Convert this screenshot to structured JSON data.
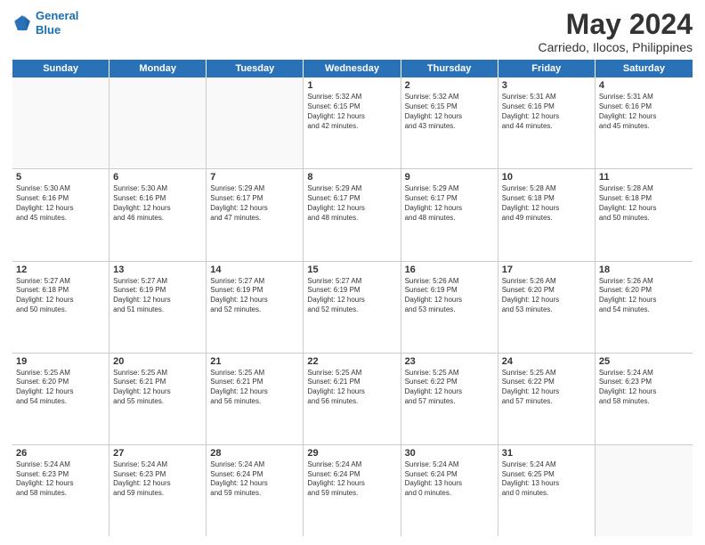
{
  "header": {
    "logo_line1": "General",
    "logo_line2": "Blue",
    "month": "May 2024",
    "location": "Carriedo, Ilocos, Philippines"
  },
  "weekdays": [
    "Sunday",
    "Monday",
    "Tuesday",
    "Wednesday",
    "Thursday",
    "Friday",
    "Saturday"
  ],
  "rows": [
    [
      {
        "day": "",
        "text": ""
      },
      {
        "day": "",
        "text": ""
      },
      {
        "day": "",
        "text": ""
      },
      {
        "day": "1",
        "text": "Sunrise: 5:32 AM\nSunset: 6:15 PM\nDaylight: 12 hours\nand 42 minutes."
      },
      {
        "day": "2",
        "text": "Sunrise: 5:32 AM\nSunset: 6:15 PM\nDaylight: 12 hours\nand 43 minutes."
      },
      {
        "day": "3",
        "text": "Sunrise: 5:31 AM\nSunset: 6:16 PM\nDaylight: 12 hours\nand 44 minutes."
      },
      {
        "day": "4",
        "text": "Sunrise: 5:31 AM\nSunset: 6:16 PM\nDaylight: 12 hours\nand 45 minutes."
      }
    ],
    [
      {
        "day": "5",
        "text": "Sunrise: 5:30 AM\nSunset: 6:16 PM\nDaylight: 12 hours\nand 45 minutes."
      },
      {
        "day": "6",
        "text": "Sunrise: 5:30 AM\nSunset: 6:16 PM\nDaylight: 12 hours\nand 46 minutes."
      },
      {
        "day": "7",
        "text": "Sunrise: 5:29 AM\nSunset: 6:17 PM\nDaylight: 12 hours\nand 47 minutes."
      },
      {
        "day": "8",
        "text": "Sunrise: 5:29 AM\nSunset: 6:17 PM\nDaylight: 12 hours\nand 48 minutes."
      },
      {
        "day": "9",
        "text": "Sunrise: 5:29 AM\nSunset: 6:17 PM\nDaylight: 12 hours\nand 48 minutes."
      },
      {
        "day": "10",
        "text": "Sunrise: 5:28 AM\nSunset: 6:18 PM\nDaylight: 12 hours\nand 49 minutes."
      },
      {
        "day": "11",
        "text": "Sunrise: 5:28 AM\nSunset: 6:18 PM\nDaylight: 12 hours\nand 50 minutes."
      }
    ],
    [
      {
        "day": "12",
        "text": "Sunrise: 5:27 AM\nSunset: 6:18 PM\nDaylight: 12 hours\nand 50 minutes."
      },
      {
        "day": "13",
        "text": "Sunrise: 5:27 AM\nSunset: 6:19 PM\nDaylight: 12 hours\nand 51 minutes."
      },
      {
        "day": "14",
        "text": "Sunrise: 5:27 AM\nSunset: 6:19 PM\nDaylight: 12 hours\nand 52 minutes."
      },
      {
        "day": "15",
        "text": "Sunrise: 5:27 AM\nSunset: 6:19 PM\nDaylight: 12 hours\nand 52 minutes."
      },
      {
        "day": "16",
        "text": "Sunrise: 5:26 AM\nSunset: 6:19 PM\nDaylight: 12 hours\nand 53 minutes."
      },
      {
        "day": "17",
        "text": "Sunrise: 5:26 AM\nSunset: 6:20 PM\nDaylight: 12 hours\nand 53 minutes."
      },
      {
        "day": "18",
        "text": "Sunrise: 5:26 AM\nSunset: 6:20 PM\nDaylight: 12 hours\nand 54 minutes."
      }
    ],
    [
      {
        "day": "19",
        "text": "Sunrise: 5:25 AM\nSunset: 6:20 PM\nDaylight: 12 hours\nand 54 minutes."
      },
      {
        "day": "20",
        "text": "Sunrise: 5:25 AM\nSunset: 6:21 PM\nDaylight: 12 hours\nand 55 minutes."
      },
      {
        "day": "21",
        "text": "Sunrise: 5:25 AM\nSunset: 6:21 PM\nDaylight: 12 hours\nand 56 minutes."
      },
      {
        "day": "22",
        "text": "Sunrise: 5:25 AM\nSunset: 6:21 PM\nDaylight: 12 hours\nand 56 minutes."
      },
      {
        "day": "23",
        "text": "Sunrise: 5:25 AM\nSunset: 6:22 PM\nDaylight: 12 hours\nand 57 minutes."
      },
      {
        "day": "24",
        "text": "Sunrise: 5:25 AM\nSunset: 6:22 PM\nDaylight: 12 hours\nand 57 minutes."
      },
      {
        "day": "25",
        "text": "Sunrise: 5:24 AM\nSunset: 6:23 PM\nDaylight: 12 hours\nand 58 minutes."
      }
    ],
    [
      {
        "day": "26",
        "text": "Sunrise: 5:24 AM\nSunset: 6:23 PM\nDaylight: 12 hours\nand 58 minutes."
      },
      {
        "day": "27",
        "text": "Sunrise: 5:24 AM\nSunset: 6:23 PM\nDaylight: 12 hours\nand 59 minutes."
      },
      {
        "day": "28",
        "text": "Sunrise: 5:24 AM\nSunset: 6:24 PM\nDaylight: 12 hours\nand 59 minutes."
      },
      {
        "day": "29",
        "text": "Sunrise: 5:24 AM\nSunset: 6:24 PM\nDaylight: 12 hours\nand 59 minutes."
      },
      {
        "day": "30",
        "text": "Sunrise: 5:24 AM\nSunset: 6:24 PM\nDaylight: 13 hours\nand 0 minutes."
      },
      {
        "day": "31",
        "text": "Sunrise: 5:24 AM\nSunset: 6:25 PM\nDaylight: 13 hours\nand 0 minutes."
      },
      {
        "day": "",
        "text": ""
      }
    ]
  ]
}
